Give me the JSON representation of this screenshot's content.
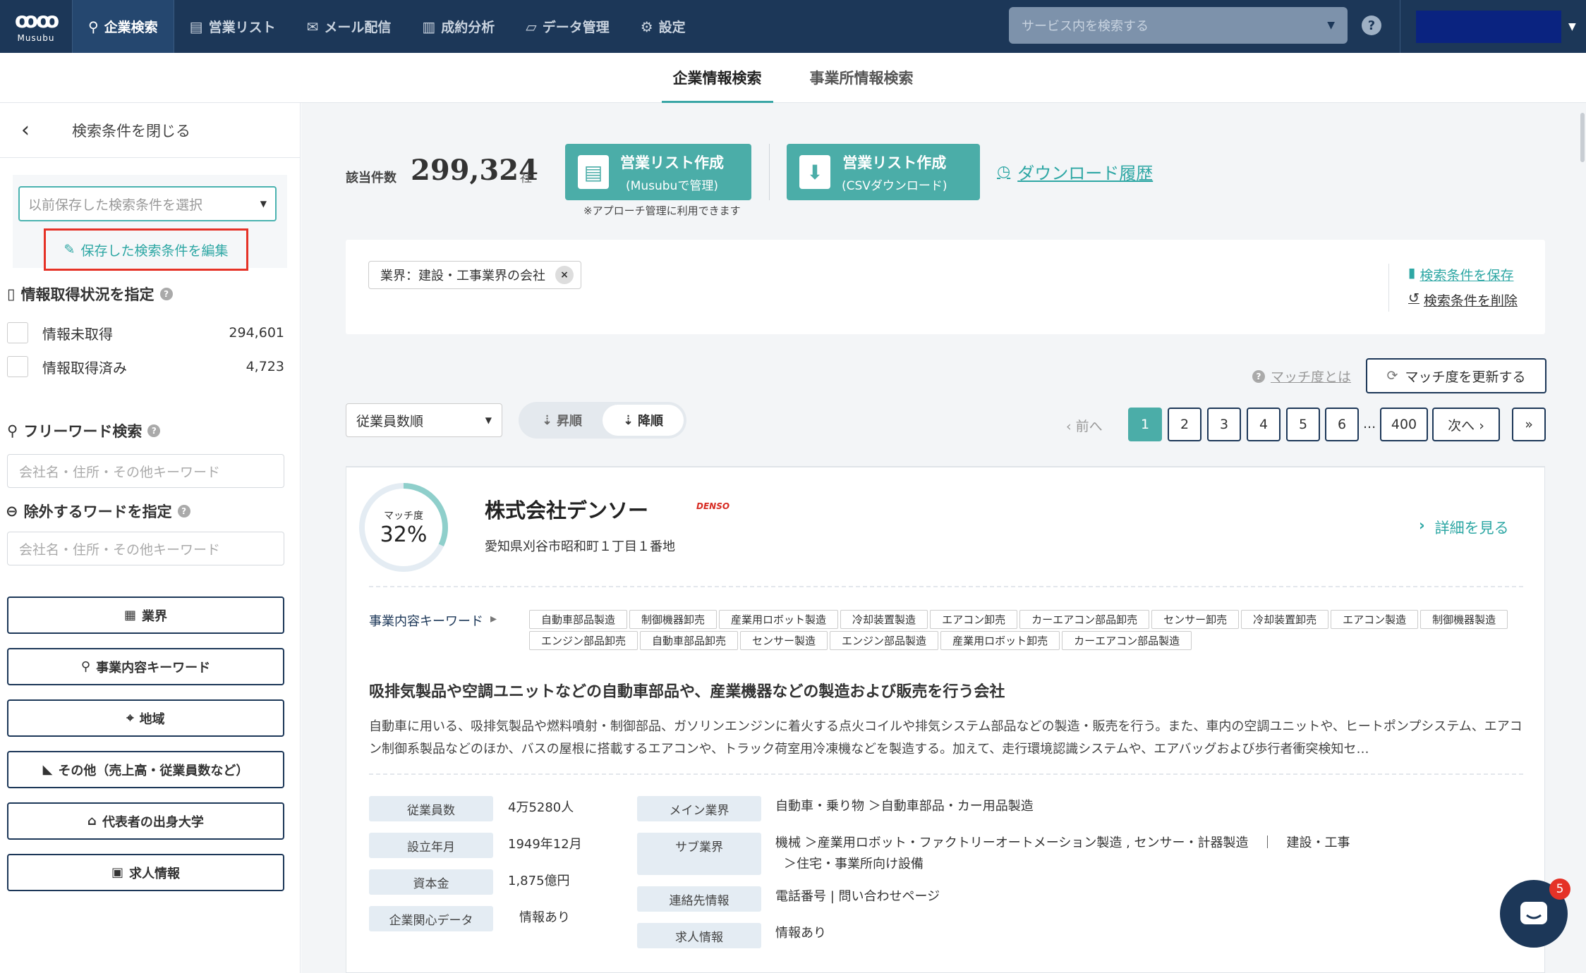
{
  "topbar": {
    "logo_text": "Musubu",
    "nav": [
      {
        "label": "企業検索",
        "icon": "search-icon"
      },
      {
        "label": "営業リスト",
        "icon": "list-icon"
      },
      {
        "label": "メール配信",
        "icon": "mail-icon"
      },
      {
        "label": "成約分析",
        "icon": "chart-icon"
      },
      {
        "label": "データ管理",
        "icon": "book-icon"
      },
      {
        "label": "設定",
        "icon": "gear-icon"
      }
    ],
    "search_placeholder": "サービス内を検索する"
  },
  "subtabs": [
    "企業情報検索",
    "事業所情報検索"
  ],
  "sidebar": {
    "close_label": "検索条件を閉じる",
    "saved_select_placeholder": "以前保存した検索条件を選択",
    "edit_saved_label": "保存した検索条件を編集",
    "info_status_title": "情報取得状況を指定",
    "info_status": [
      {
        "label": "情報未取得",
        "count": "294,601"
      },
      {
        "label": "情報取得済み",
        "count": "4,723"
      }
    ],
    "freeword_title": "フリーワード検索",
    "freeword_placeholder": "会社名・住所・その他キーワード",
    "exclude_title": "除外するワードを指定",
    "exclude_placeholder": "会社名・住所・その他キーワード",
    "filters": [
      "業界",
      "事業内容キーワード",
      "地域",
      "その他（売上高・従業員数など）",
      "代表者の出身大学",
      "求人情報"
    ]
  },
  "results": {
    "count_label": "該当件数",
    "count": "299,324",
    "count_unit": "社",
    "list_btn_1": {
      "line1": "営業リスト作成",
      "line2": "(Musubuで管理)"
    },
    "list_btn_note": "※アプローチ管理に利用できます",
    "list_btn_2": {
      "line1": "営業リスト作成",
      "line2": "(CSVダウンロード)"
    },
    "download_history": "ダウンロード履歴",
    "chip": "業界：建設・工事業界の会社",
    "chip_close": "×",
    "save_condition": "検索条件を保存",
    "delete_condition": "検索条件を削除",
    "match_about": "マッチ度とは",
    "match_update": "マッチ度を更新する",
    "sort_select": "従業員数順",
    "asc": "昇順",
    "desc": "降順",
    "prev": "‹ 前へ",
    "pages": [
      "1",
      "2",
      "3",
      "4",
      "5",
      "6"
    ],
    "dots": "...",
    "last_page": "400",
    "next": "次へ ›",
    "last": "»"
  },
  "company": {
    "match_label": "マッチ度",
    "match_value": "32%",
    "match_fraction": 0.32,
    "name": "株式会社デンソー",
    "logo_text": "DENSO",
    "address": "愛知県刈谷市昭和町１丁目１番地",
    "detail_link": "詳細を見る",
    "keyword_title": "事業内容キーワード",
    "keywords": [
      "自動車部品製造",
      "制御機器卸売",
      "産業用ロボット製造",
      "冷却装置製造",
      "エアコン卸売",
      "カーエアコン部品卸売",
      "センサー卸売",
      "冷却装置卸売",
      "エアコン製造",
      "制御機器製造",
      "エンジン部品卸売",
      "自動車部品卸売",
      "センサー製造",
      "エンジン部品製造",
      "産業用ロボット卸売",
      "カーエアコン部品製造"
    ],
    "summary": "吸排気製品や空調ユニットなどの自動車部品や、産業機器などの製造および販売を行う会社",
    "description": "自動車に用いる、吸排気製品や燃料噴射・制御部品、ガソリンエンジンに着火する点火コイルや排気システム部品などの製造・販売を行う。また、車内の空調ユニットや、ヒートポンプシステム、エアコン制御系製品などのほか、バスの屋根に搭載するエアコンや、トラック荷室用冷凍機などを製造する。加えて、走行環境認識システムや、エアバッグおよび歩行者衝突検知セ…",
    "info_left": [
      {
        "label": "従業員数",
        "value": "4万5280人"
      },
      {
        "label": "設立年月",
        "value": "1949年12月"
      },
      {
        "label": "資本金",
        "value": "1,875億円"
      },
      {
        "label": "企業関心データ",
        "value": "情報あり"
      }
    ],
    "main_industry_label": "メイン業界",
    "main_industry": "自動車・乗り物 ＞自動車部品・カー用品製造",
    "sub_industry_label": "サブ業界",
    "sub_industry_line1": "機械 ＞産業用ロボット・ファクトリーオートメーション製造 , センサー・計器製造　｜　建設・工事",
    "sub_industry_line2": "＞住宅・事業所向け設備",
    "contact_label": "連絡先情報",
    "contact": "電話番号 | 問い合わせページ",
    "job_label": "求人情報",
    "job": "情報あり"
  },
  "chat_badge": "5",
  "colors": {
    "navy": "#1c3758",
    "teal": "#4bada8",
    "red": "#e53227"
  }
}
